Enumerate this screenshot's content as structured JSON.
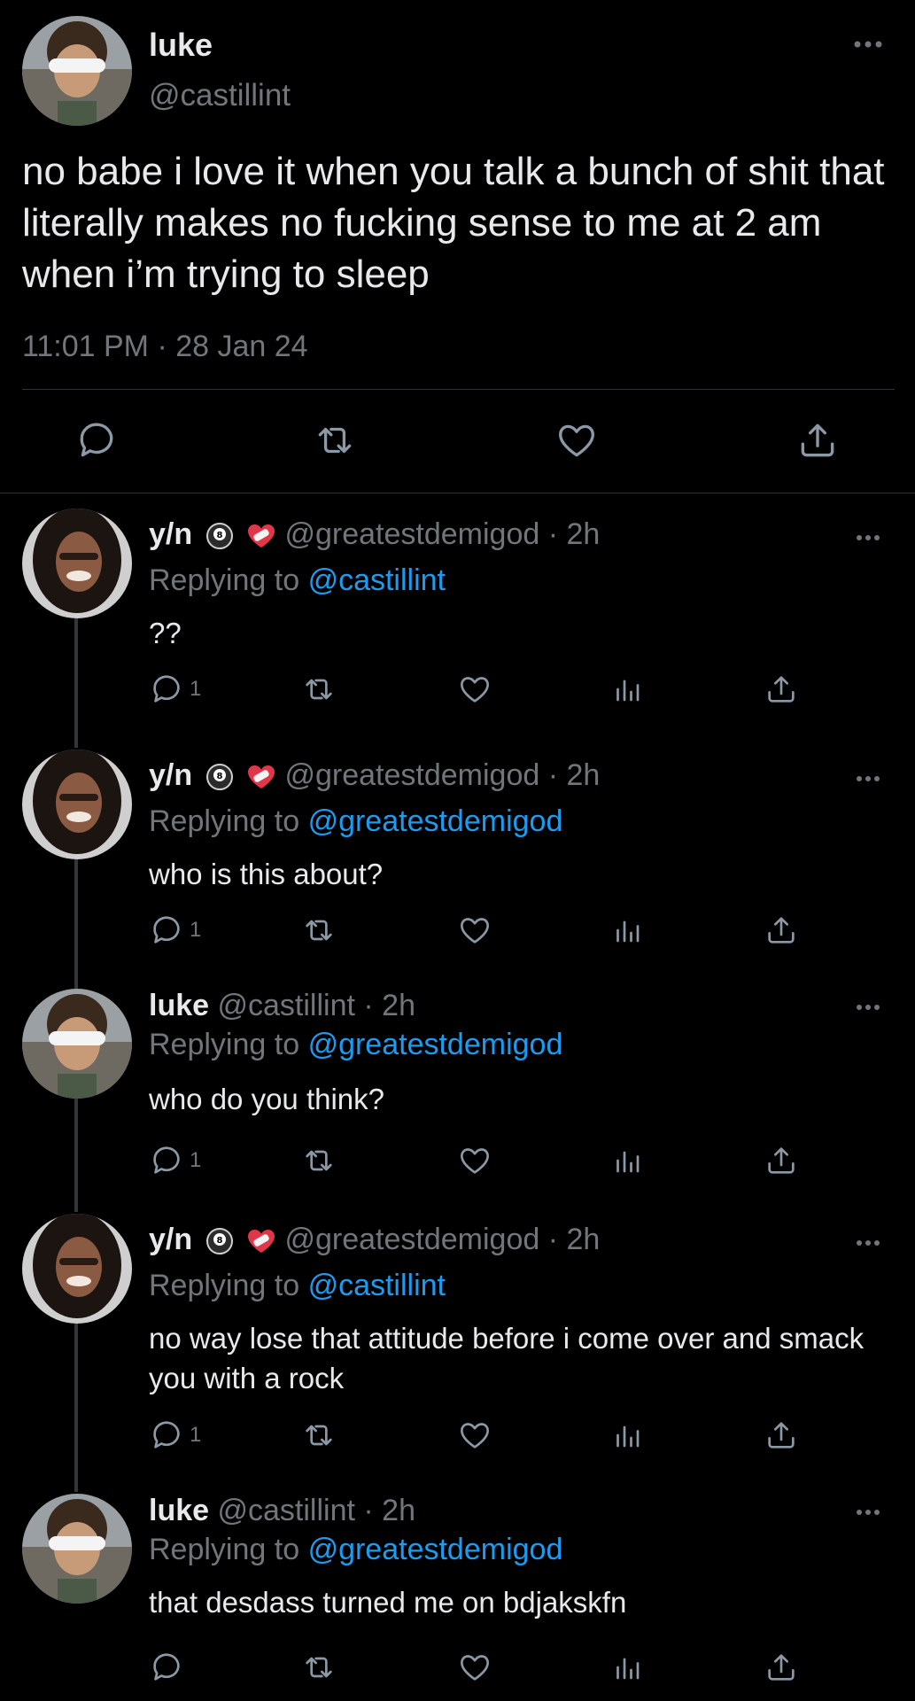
{
  "main_tweet": {
    "name": "luke",
    "handle": "@castillint",
    "text": "no babe i love it when you talk a bunch of shit that literally makes no fucking sense to me at 2 am when i’m trying to sleep",
    "timestamp": "11:01 PM · 28 Jan 24"
  },
  "replies": [
    {
      "name": "y/n",
      "badges": [
        "8-ball-icon",
        "heart-bandage-icon"
      ],
      "handle": "@greatestdemigod",
      "time": "· 2h",
      "replying_prefix": "Replying to",
      "replying_to": "@castillint",
      "text": "??",
      "reply_count": "1"
    },
    {
      "name": "y/n",
      "badges": [
        "8-ball-icon",
        "heart-bandage-icon"
      ],
      "handle": "@greatestdemigod",
      "time": "· 2h",
      "replying_prefix": "Replying to",
      "replying_to": "@greatestdemigod",
      "text": "who is this about?",
      "reply_count": "1"
    },
    {
      "name": "luke",
      "handle": "@castillint",
      "time": "· 2h",
      "replying_prefix": "Replying to",
      "replying_to": "@greatestdemigod",
      "text": "who do you think?",
      "reply_count": "1"
    },
    {
      "name": "y/n",
      "badges": [
        "8-ball-icon",
        "heart-bandage-icon"
      ],
      "handle": "@greatestdemigod",
      "time": "· 2h",
      "replying_prefix": "Replying to",
      "replying_to": "@castillint",
      "text": "no way lose that attitude before i come over and smack you with a rock",
      "reply_count": "1"
    },
    {
      "name": "luke",
      "handle": "@castillint",
      "time": "· 2h",
      "replying_prefix": "Replying to",
      "replying_to": "@greatestdemigod",
      "text": "that desdass turned me on bdjakskfn",
      "reply_count": ""
    }
  ],
  "colors": {
    "background": "#000000",
    "text": "#e7e9ea",
    "muted": "#71767b",
    "link": "#1d9bf0",
    "divider": "#2f3336"
  }
}
